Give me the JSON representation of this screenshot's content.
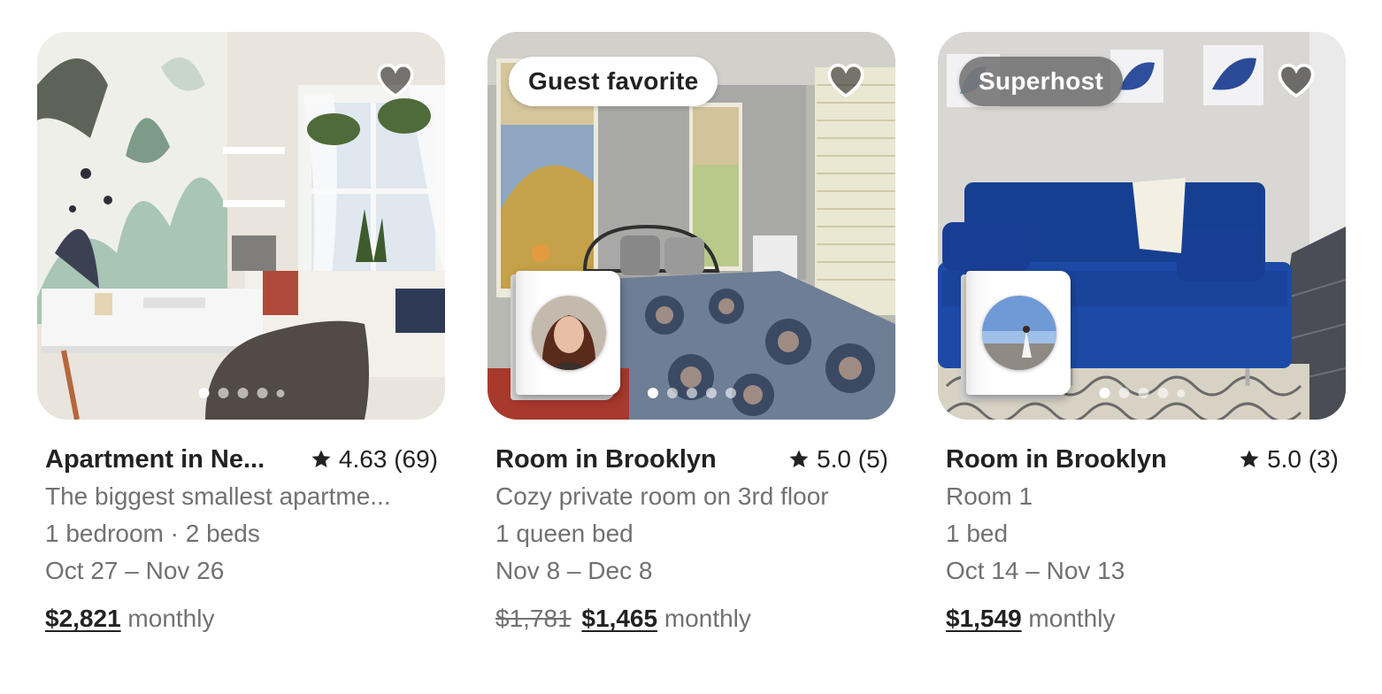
{
  "listings": [
    {
      "badge": "",
      "title": "Apartment in Ne...",
      "rating": "4.63 (69)",
      "description": "The biggest smallest apartme...",
      "beds": "1 bedroom · 2 beds",
      "dates": "Oct 27 – Nov 26",
      "original_price": "",
      "price": "$2,821",
      "price_unit": "monthly",
      "photo_count": 5,
      "active_photo": 1,
      "saved": false
    },
    {
      "badge": "Guest favorite",
      "title": "Room in Brooklyn",
      "rating": "5.0 (5)",
      "description": "Cozy private room on 3rd floor",
      "beds": "1 queen bed",
      "dates": "Nov 8 – Dec 8",
      "original_price": "$1,781",
      "price": "$1,465",
      "price_unit": "monthly",
      "photo_count": 5,
      "active_photo": 1,
      "saved": false
    },
    {
      "badge": "Superhost",
      "title": "Room in Brooklyn",
      "rating": "5.0 (3)",
      "description": "Room 1",
      "beds": "1 bed",
      "dates": "Oct 14 – Nov 13",
      "original_price": "",
      "price": "$1,549",
      "price_unit": "monthly",
      "photo_count": 5,
      "active_photo": 1,
      "saved": false
    }
  ],
  "colors": {
    "text_primary": "#222222",
    "text_secondary": "#717171",
    "badge_light_bg": "#ffffff",
    "badge_dark_bg": "#6e6e6e"
  },
  "icons": {
    "favorite": "heart-outline-icon",
    "rating": "star-icon"
  }
}
